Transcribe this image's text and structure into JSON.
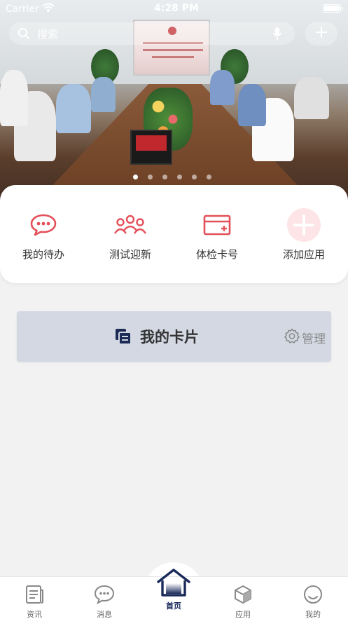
{
  "status_bar": {
    "carrier": "Carrier",
    "time": "4:28 PM"
  },
  "search": {
    "placeholder": "搜索"
  },
  "banner": {
    "slide_count": 6,
    "active_slide": 1
  },
  "quick_apps": [
    {
      "label": "我的待办",
      "icon": "chat-dots-icon"
    },
    {
      "label": "测试迎新",
      "icon": "people-group-icon"
    },
    {
      "label": "体检卡号",
      "icon": "card-icon"
    },
    {
      "label": "添加应用",
      "icon": "plus-circle-icon"
    }
  ],
  "my_cards": {
    "title": "我的卡片",
    "manage_label": "管理"
  },
  "tabs": [
    {
      "label": "资讯",
      "icon": "news-icon",
      "active": false
    },
    {
      "label": "消息",
      "icon": "message-icon",
      "active": false
    },
    {
      "label": "首页",
      "icon": "home-icon",
      "active": true
    },
    {
      "label": "应用",
      "icon": "app-cube-icon",
      "active": false
    },
    {
      "label": "我的",
      "icon": "profile-icon",
      "active": false
    }
  ],
  "colors": {
    "accent_red": "#e4505a",
    "nav_active": "#1a2a5a",
    "card_bg": "#d3d8e3"
  }
}
